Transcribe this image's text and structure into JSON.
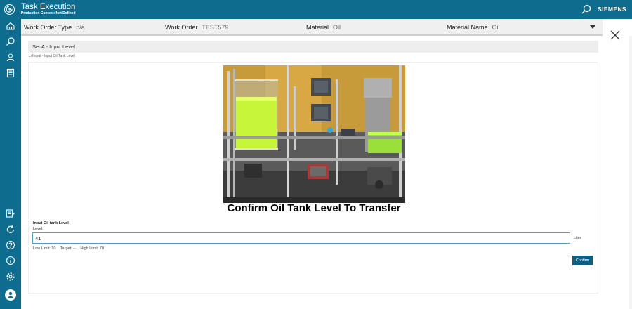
{
  "header": {
    "title": "Task Execution",
    "subtitle": "Production Context: Not Defined",
    "brand": "SIEMENS"
  },
  "info_bar": {
    "work_order_type_label": "Work Order Type",
    "work_order_type_value": "n/a",
    "work_order_label": "Work Order",
    "work_order_value": "TEST579",
    "material_label": "Material",
    "material_value": "Oil",
    "material_name_label": "Material Name",
    "material_name_value": "Oil"
  },
  "section": {
    "title": "SecA - Input Level",
    "path": "LvlInput - Input Oil Tank Level"
  },
  "task": {
    "headline": "Confirm Oil Tank Level To Transfer",
    "field_title": "Input Oil tank Level",
    "field_label": "Level:",
    "field_value": "41",
    "unit": "Liter",
    "low_limit": "Low Limit: 10",
    "target": "Target: --",
    "high_limit": "High Limit: 70",
    "confirm_label": "Confirm"
  },
  "icons": {
    "sidebar": [
      "home-icon",
      "search-icon",
      "users-icon",
      "report-icon",
      "tasks-icon",
      "refresh-icon",
      "help-icon",
      "info-icon",
      "settings-icon"
    ],
    "accent": "#0e6d8f",
    "button": "#0e5f84",
    "input_border": "#4aa3c7"
  }
}
